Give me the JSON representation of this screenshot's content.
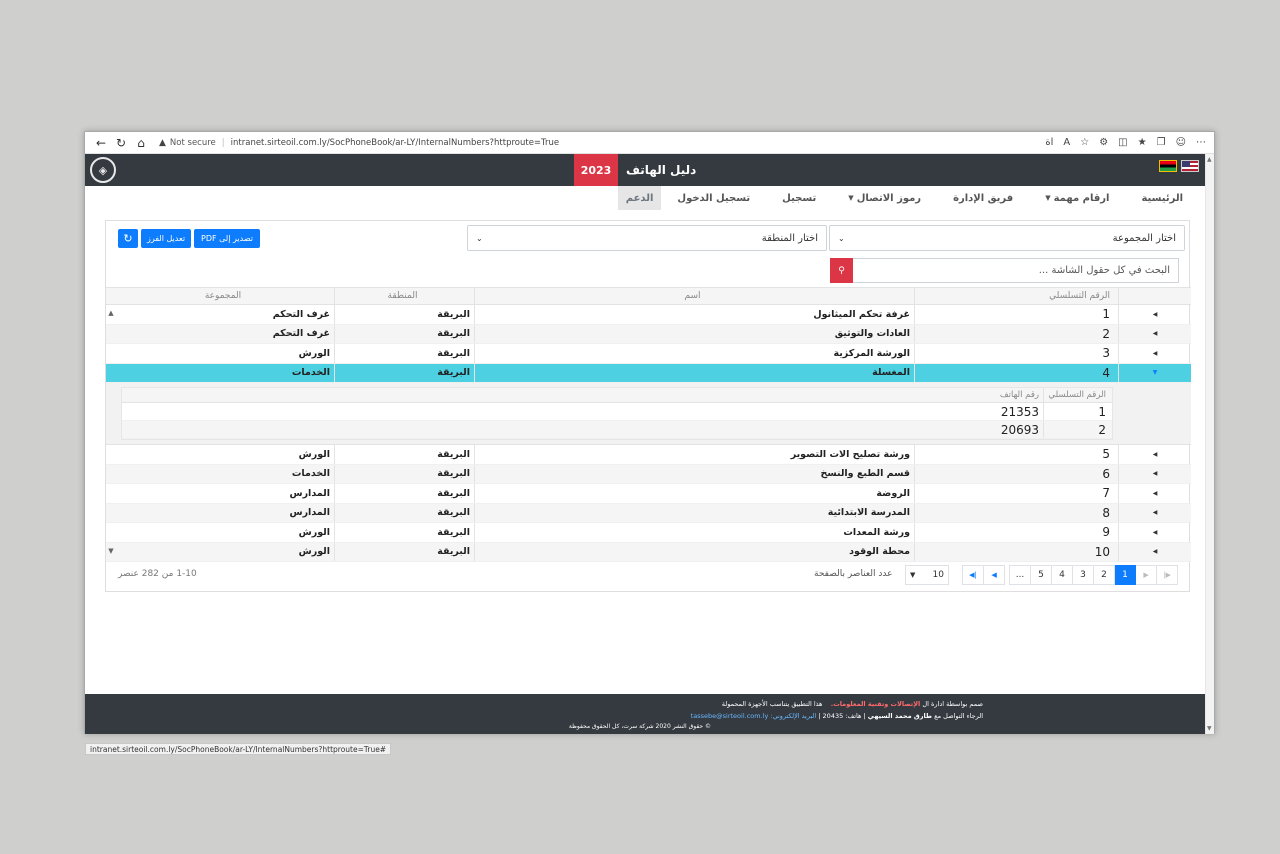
{
  "browser": {
    "security": "Not secure",
    "url": "intranet.sirteoil.com.ly/SocPhoneBook/ar-LY/InternalNumbers?httproute=True",
    "status_url": "intranet.sirteoil.com.ly/SocPhoneBook/ar-LY/InternalNumbers?httproute=True#"
  },
  "header": {
    "year": "2023",
    "title": "دليل الهاتف"
  },
  "menu": [
    {
      "label": "الرئيسية",
      "caret": false,
      "active": false
    },
    {
      "label": "ارقام مهمة",
      "caret": true,
      "active": false
    },
    {
      "label": "فريق الإدارة",
      "caret": false,
      "active": false
    },
    {
      "label": "رموز الاتصال",
      "caret": true,
      "active": false
    },
    {
      "label": "تسجيل",
      "caret": false,
      "active": false
    },
    {
      "label": "تسجيل الدخول",
      "caret": false,
      "active": false
    },
    {
      "label": "الدعم",
      "caret": false,
      "active": true
    }
  ],
  "filters": {
    "group_placeholder": "اختار المجموعة",
    "area_placeholder": "اختار المنطقة",
    "search_placeholder": "البحث في كل حقول الشاشة ...",
    "export_pdf": "تصدير إلى PDF",
    "edit_sort": "تعديل الفرز"
  },
  "grid": {
    "columns": [
      "الرقم التسلسلي",
      "اسم",
      "المنطقة",
      "المجموعة"
    ],
    "rows": [
      {
        "serial": "1",
        "name": "غرفة تحكم الميثانول",
        "area": "البريقة",
        "group": "غرف التحكم"
      },
      {
        "serial": "2",
        "name": "العادات والتوثيق",
        "area": "البريقة",
        "group": "غرف التحكم"
      },
      {
        "serial": "3",
        "name": "الورشة المركزية",
        "area": "البريقة",
        "group": "الورش"
      },
      {
        "serial": "4",
        "name": "المغسلة",
        "area": "البريقة",
        "group": "الخدمات"
      },
      {
        "serial": "5",
        "name": "ورشة تصليح الات التصوير",
        "area": "البريقة",
        "group": "الورش"
      },
      {
        "serial": "6",
        "name": "قسم الطبع والنسخ",
        "area": "البريقة",
        "group": "الخدمات"
      },
      {
        "serial": "7",
        "name": "الروضة",
        "area": "البريقة",
        "group": "المدارس"
      },
      {
        "serial": "8",
        "name": "المدرسة الابتدائية",
        "area": "البريقة",
        "group": "المدارس"
      },
      {
        "serial": "9",
        "name": "ورشة المعدات",
        "area": "البريقة",
        "group": "الورش"
      },
      {
        "serial": "10",
        "name": "محطة الوقود",
        "area": "البريقة",
        "group": "الورش"
      }
    ],
    "detail": {
      "columns": [
        "الرقم التسلسلي",
        "رقم الهاتف"
      ],
      "rows": [
        {
          "serial": "1",
          "phone": "21353"
        },
        {
          "serial": "2",
          "phone": "20693"
        }
      ]
    }
  },
  "pager": {
    "pages": [
      "1",
      "2",
      "3",
      "4",
      "5",
      "..."
    ],
    "page_size": "10",
    "page_size_label": "عدد العناصر بالصفحة",
    "info": "1-10 من 282 عنصر"
  },
  "footer": {
    "line1_a": "صمم بواسطة ادارة ال",
    "line1_b": "الإتصالات وتقنية المعلومات.",
    "line1_c": "هذا التطبيق يتناسب الأجهزة المحمولة",
    "line2_a": "الرجاء التواصل مع",
    "line2_name": "طارق محمد السيهي",
    "line2_b": "| هاتف: 20435 |",
    "line2_email_label": "البريد الإلكتروني:",
    "line2_email": "tassebe@sirteoil.com.ly",
    "line3": "© حقوق النشر 2020 شركة سرت، كل الحقوق محفوظة"
  },
  "colors": {
    "accent": "#0d7dfd",
    "selected_row": "#4dd0e1",
    "danger": "#dc3545",
    "dark": "#343a40"
  }
}
